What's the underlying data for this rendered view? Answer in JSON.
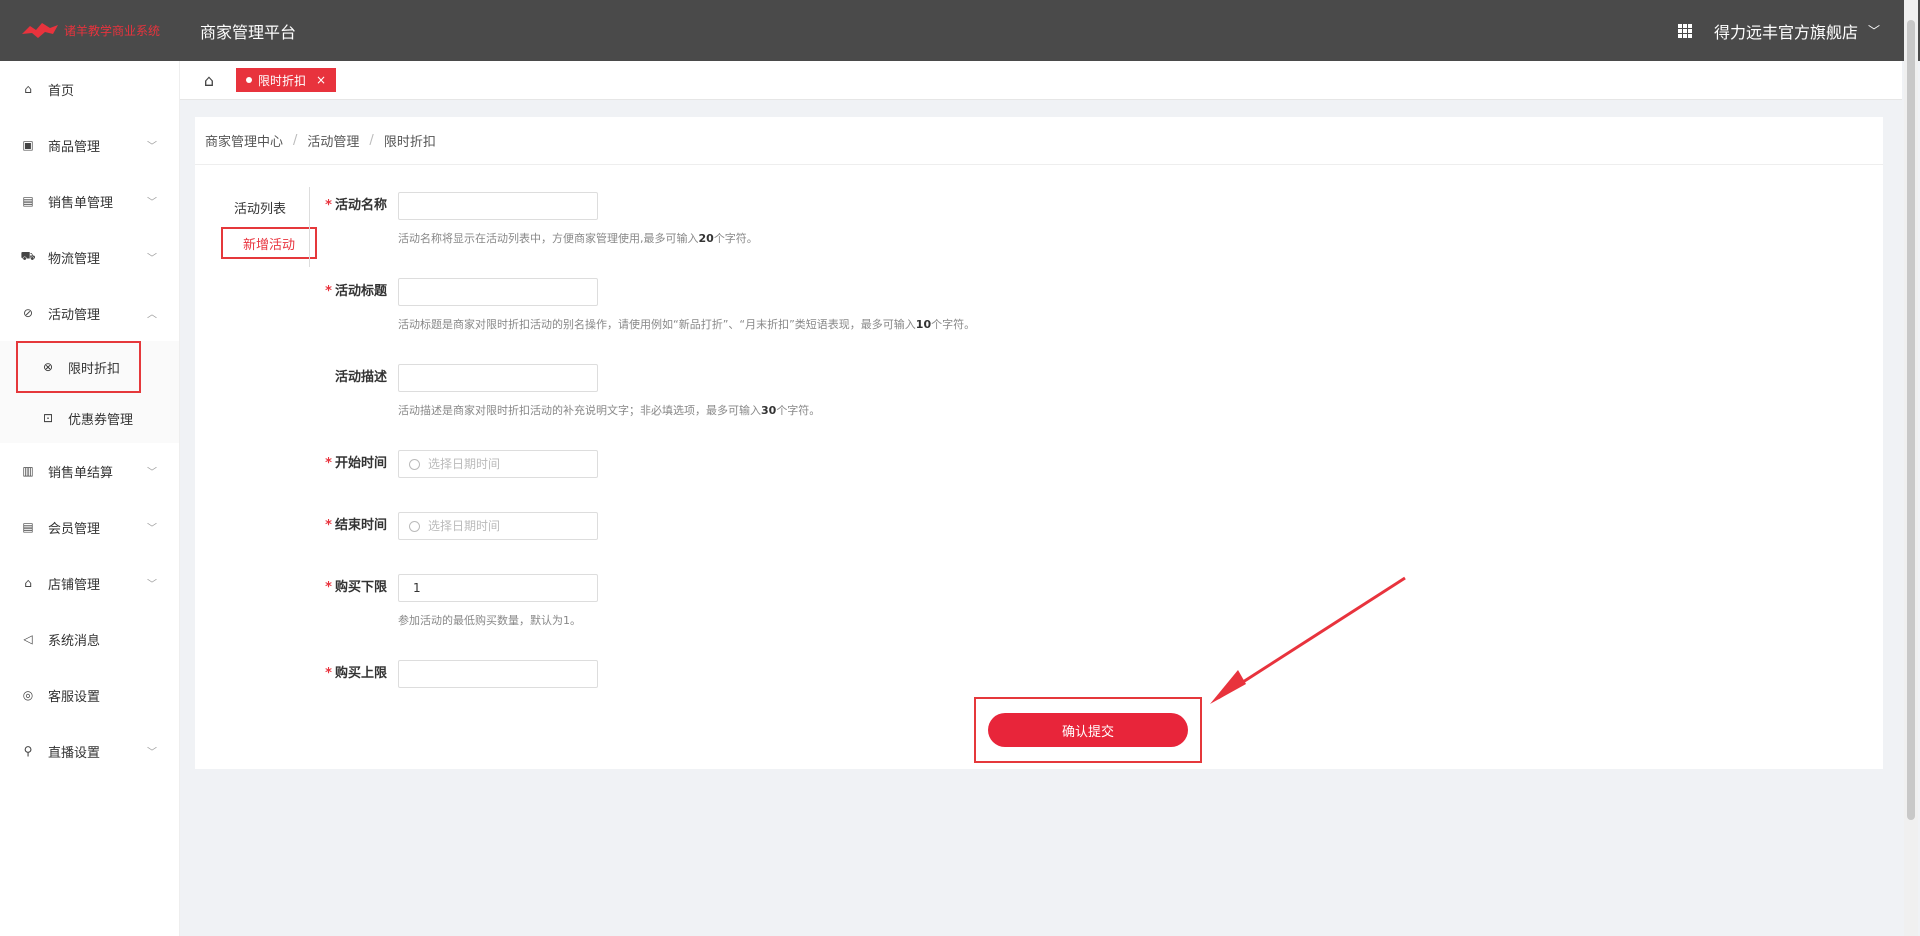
{
  "header": {
    "logo_text": "诸羊教学商业系统",
    "platform_title": "商家管理平台",
    "store_name": "得力远丰官方旗舰店"
  },
  "sidebar": {
    "items": [
      {
        "label": "首页",
        "icon": "home-icon"
      },
      {
        "label": "商品管理",
        "icon": "box-icon"
      },
      {
        "label": "销售单管理",
        "icon": "clipboard-icon"
      },
      {
        "label": "物流管理",
        "icon": "truck-icon"
      },
      {
        "label": "活动管理",
        "icon": "tag-icon"
      },
      {
        "label": "销售单结算",
        "icon": "document-icon"
      },
      {
        "label": "会员管理",
        "icon": "clipboard-icon"
      },
      {
        "label": "店铺管理",
        "icon": "shop-icon"
      },
      {
        "label": "系统消息",
        "icon": "speaker-icon"
      },
      {
        "label": "客服设置",
        "icon": "headset-icon"
      },
      {
        "label": "直播设置",
        "icon": "search-icon"
      }
    ],
    "sub_items": [
      {
        "label": "限时折扣",
        "icon": "discount-icon"
      },
      {
        "label": "优惠券管理",
        "icon": "coupon-icon"
      }
    ]
  },
  "tabbar": {
    "active_tag": "限时折扣",
    "close_glyph": "×"
  },
  "breadcrumb": [
    "商家管理中心",
    "活动管理",
    "限时折扣"
  ],
  "left_nav": [
    "活动列表",
    "新增活动"
  ],
  "form": {
    "name_label": "活动名称",
    "name_hint_pre": "活动名称将显示在活动列表中，方便商家管理使用,最多可输入",
    "name_hint_num": "20",
    "name_hint_post": "个字符。",
    "title_label": "活动标题",
    "title_hint_pre": "活动标题是商家对限时折扣活动的别名操作，请使用例如“新品打折”、“月末折扣”类短语表现，最多可输入",
    "title_hint_num": "10",
    "title_hint_post": "个字符。",
    "desc_label": "活动描述",
    "desc_hint_pre": "活动描述是商家对限时折扣活动的补充说明文字；非必填选项，最多可输入",
    "desc_hint_num": "30",
    "desc_hint_post": "个字符。",
    "start_label": "开始时间",
    "start_placeholder": "选择日期时间",
    "end_label": "结束时间",
    "end_placeholder": "选择日期时间",
    "min_label": "购买下限",
    "min_value": "1",
    "min_hint": "参加活动的最低购买数量，默认为1。",
    "max_label": "购买上限",
    "submit_label": "确认提交",
    "required_mark": "*"
  },
  "colors": {
    "brand": "#e8333d",
    "header_bg": "#4a4a4a"
  }
}
